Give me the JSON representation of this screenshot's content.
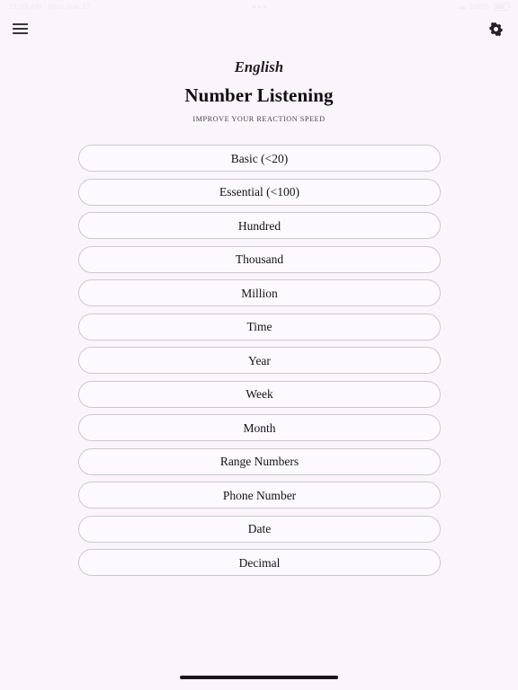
{
  "status_bar": {
    "time": "11:53 AM",
    "date": "Mon Jun 17",
    "wifi_icon": "wifi-icon",
    "battery_level": "100%",
    "battery_icon": "battery-icon",
    "multitask_indicator": "three-dots-icon"
  },
  "nav": {
    "menu_icon": "hamburger-menu-icon",
    "settings_icon": "gear-icon"
  },
  "header": {
    "language": "English",
    "title": "Number Listening",
    "subtitle": "IMPROVE YOUR REACTION SPEED"
  },
  "modes": [
    {
      "label": "Basic (<20)"
    },
    {
      "label": "Essential (<100)"
    },
    {
      "label": "Hundred"
    },
    {
      "label": "Thousand"
    },
    {
      "label": "Million"
    },
    {
      "label": "Time"
    },
    {
      "label": "Year"
    },
    {
      "label": "Week"
    },
    {
      "label": "Month"
    },
    {
      "label": "Range Numbers"
    },
    {
      "label": "Phone Number"
    },
    {
      "label": "Date"
    },
    {
      "label": "Decimal"
    }
  ],
  "extra_mode": {
    "label": "Decimal"
  },
  "colors": {
    "background": "#faf4fb",
    "button_fill": "#fdfaff",
    "button_border": "#cfc6d4",
    "text": "#151019",
    "icon": "#3a3340"
  }
}
